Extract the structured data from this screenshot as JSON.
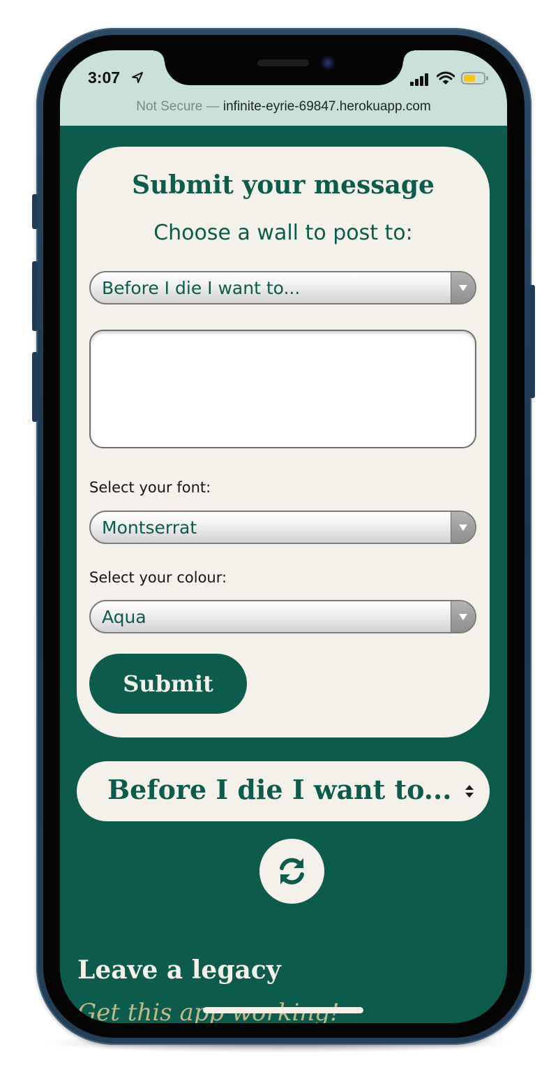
{
  "status_bar": {
    "time": "3:07",
    "icons": [
      "location-arrow-icon",
      "cellular-signal-icon",
      "wifi-icon",
      "battery-icon"
    ],
    "battery_color": "#f5c518"
  },
  "browser": {
    "security_label": "Not Secure —",
    "host": "infinite-eyrie-69847.herokuapp.com"
  },
  "form": {
    "title": "Submit your message",
    "subtitle": "Choose a wall to post to:",
    "wall_select_value": "Before I die I want to...",
    "message_value": "",
    "font_label": "Select your font:",
    "font_select_value": "Montserrat",
    "colour_label": "Select your colour:",
    "colour_select_value": "Aqua",
    "submit_label": "Submit"
  },
  "wall_picker": {
    "value": "Before I die I want to..."
  },
  "refresh": {
    "icon": "refresh-icon"
  },
  "legacy": {
    "title": "Leave a legacy",
    "subtitle": "Get this app working!"
  },
  "colors": {
    "brand_green": "#0c5b4c",
    "cream": "#f4f1ea",
    "status_bar_bg": "#cae0da",
    "accent_gold": "#bfb888"
  }
}
